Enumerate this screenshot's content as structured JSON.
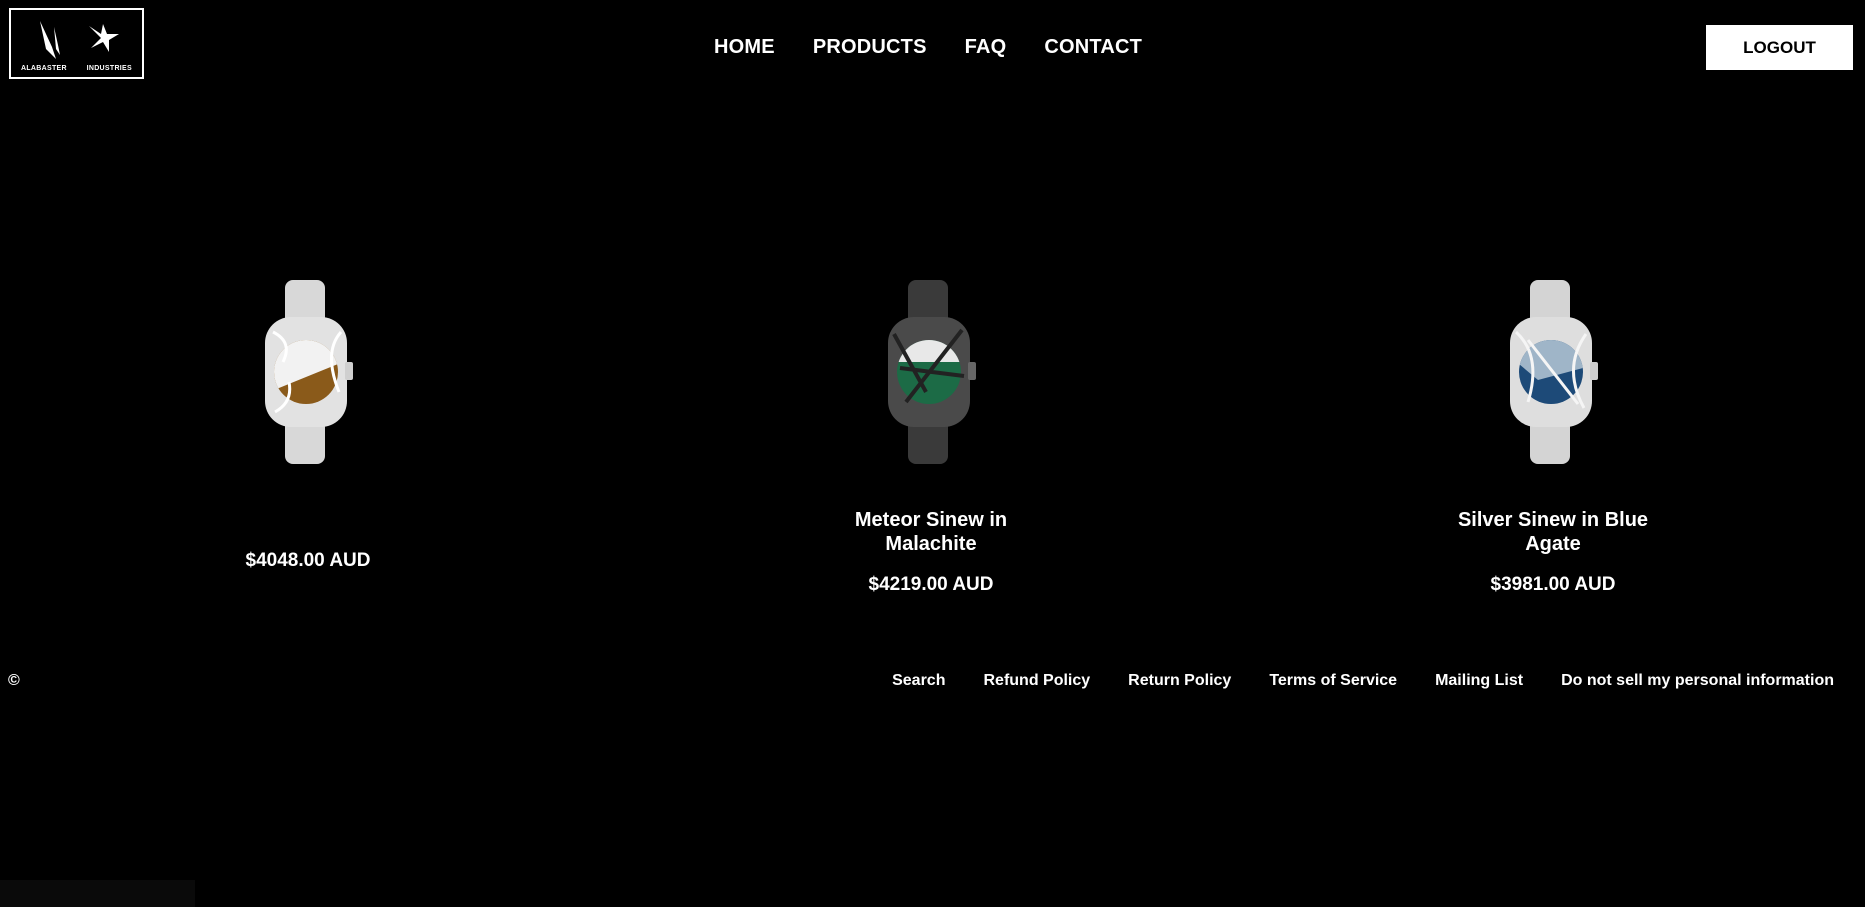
{
  "brand": {
    "name_left": "ALABASTER",
    "name_right": "INDUSTRIES"
  },
  "nav": {
    "items": [
      "HOME",
      "PRODUCTS",
      "FAQ",
      "CONTACT"
    ]
  },
  "header": {
    "logout_label": "LOGOUT"
  },
  "products": [
    {
      "title": "",
      "price": "$4048.00 AUD",
      "metal_color": "#d8d8d8",
      "dial_colors": [
        "#f2f2f2",
        "#8a5a1a"
      ]
    },
    {
      "title": "Meteor Sinew in Malachite",
      "price": "$4219.00 AUD",
      "metal_color": "#3a3a3a",
      "dial_colors": [
        "#e8e8e8",
        "#1c6b46"
      ]
    },
    {
      "title": "Silver Sinew in Blue Agate",
      "price": "$3981.00 AUD",
      "metal_color": "#d4d4d4",
      "dial_colors": [
        "#9fb5c8",
        "#1d4a78"
      ]
    }
  ],
  "footer": {
    "copyright": "©",
    "links": [
      "Search",
      "Refund Policy",
      "Return Policy",
      "Terms of Service",
      "Mailing List",
      "Do not sell my personal information"
    ]
  }
}
